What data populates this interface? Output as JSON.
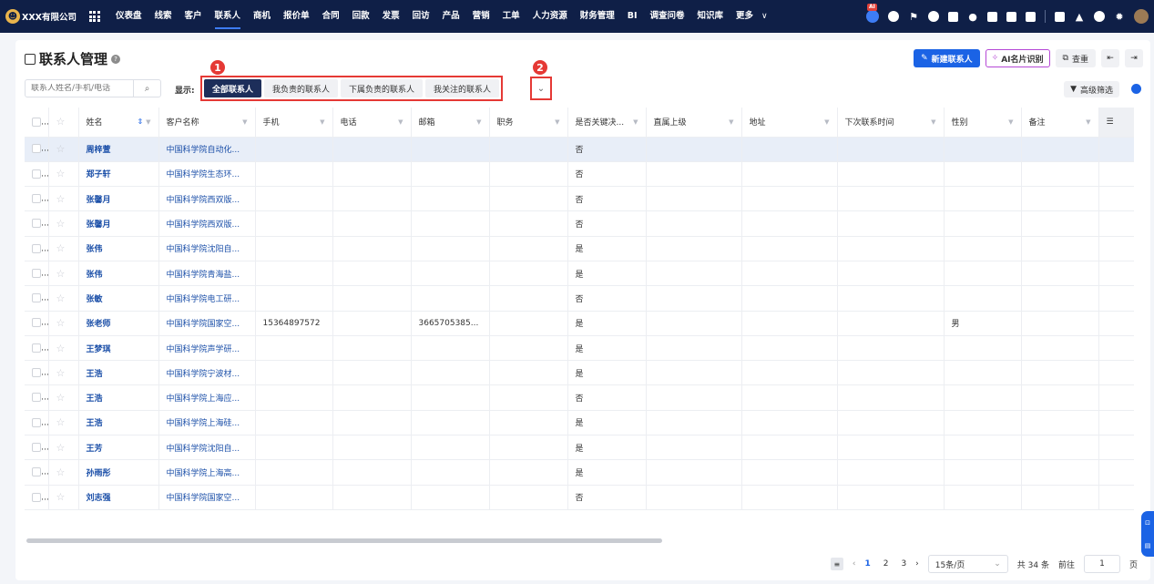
{
  "brand": {
    "name": "XXX有限公司"
  },
  "nav": {
    "items": [
      "仪表盘",
      "线索",
      "客户",
      "联系人",
      "商机",
      "报价单",
      "合同",
      "回款",
      "发票",
      "回访",
      "产品",
      "营销",
      "工单",
      "人力资源",
      "财务管理",
      "BI",
      "调查问卷",
      "知识库",
      "更多"
    ],
    "active": "联系人",
    "more_glyph": "∨",
    "ai_badge": "AI"
  },
  "page": {
    "title": "联系人管理",
    "help": "?"
  },
  "actions": {
    "new_contact": "新建联系人",
    "ai_card": "AI名片识别",
    "dedupe": "查重"
  },
  "search": {
    "placeholder": "联系人姓名/手机/电话"
  },
  "filters": {
    "show_label": "显示:",
    "tabs": [
      "全部联系人",
      "我负责的联系人",
      "下属负责的联系人",
      "我关注的联系人"
    ],
    "active_tab": "全部联系人",
    "advanced": "高级筛选"
  },
  "annotations": {
    "badge1": "1",
    "badge2": "2"
  },
  "table": {
    "columns": [
      "姓名",
      "客户名称",
      "手机",
      "电话",
      "邮箱",
      "职务",
      "是否关键决...",
      "直属上级",
      "地址",
      "下次联系时间",
      "性别",
      "备注"
    ],
    "rows": [
      {
        "name": "周梓萱",
        "customer": "中国科学院自动化...",
        "mobile": "",
        "phone": "",
        "email": "",
        "title": "",
        "key": "否",
        "boss": "",
        "addr": "",
        "next": "",
        "gender": "",
        "note": ""
      },
      {
        "name": "郑子轩",
        "customer": "中国科学院生态环...",
        "mobile": "",
        "phone": "",
        "email": "",
        "title": "",
        "key": "否",
        "boss": "",
        "addr": "",
        "next": "",
        "gender": "",
        "note": ""
      },
      {
        "name": "张馨月",
        "customer": "中国科学院西双版...",
        "mobile": "",
        "phone": "",
        "email": "",
        "title": "",
        "key": "否",
        "boss": "",
        "addr": "",
        "next": "",
        "gender": "",
        "note": ""
      },
      {
        "name": "张馨月",
        "customer": "中国科学院西双版...",
        "mobile": "",
        "phone": "",
        "email": "",
        "title": "",
        "key": "否",
        "boss": "",
        "addr": "",
        "next": "",
        "gender": "",
        "note": ""
      },
      {
        "name": "张伟",
        "customer": "中国科学院沈阳自...",
        "mobile": "",
        "phone": "",
        "email": "",
        "title": "",
        "key": "是",
        "boss": "",
        "addr": "",
        "next": "",
        "gender": "",
        "note": ""
      },
      {
        "name": "张伟",
        "customer": "中国科学院青海盐...",
        "mobile": "",
        "phone": "",
        "email": "",
        "title": "",
        "key": "是",
        "boss": "",
        "addr": "",
        "next": "",
        "gender": "",
        "note": ""
      },
      {
        "name": "张敏",
        "customer": "中国科学院电工研...",
        "mobile": "",
        "phone": "",
        "email": "",
        "title": "",
        "key": "否",
        "boss": "",
        "addr": "",
        "next": "",
        "gender": "",
        "note": ""
      },
      {
        "name": "张老师",
        "customer": "中国科学院国家空...",
        "mobile": "15364897572",
        "phone": "",
        "email": "3665705385...",
        "title": "",
        "key": "是",
        "boss": "",
        "addr": "",
        "next": "",
        "gender": "男",
        "note": ""
      },
      {
        "name": "王梦琪",
        "customer": "中国科学院声学研...",
        "mobile": "",
        "phone": "",
        "email": "",
        "title": "",
        "key": "是",
        "boss": "",
        "addr": "",
        "next": "",
        "gender": "",
        "note": ""
      },
      {
        "name": "王浩",
        "customer": "中国科学院宁波材...",
        "mobile": "",
        "phone": "",
        "email": "",
        "title": "",
        "key": "是",
        "boss": "",
        "addr": "",
        "next": "",
        "gender": "",
        "note": ""
      },
      {
        "name": "王浩",
        "customer": "中国科学院上海应...",
        "mobile": "",
        "phone": "",
        "email": "",
        "title": "",
        "key": "否",
        "boss": "",
        "addr": "",
        "next": "",
        "gender": "",
        "note": ""
      },
      {
        "name": "王浩",
        "customer": "中国科学院上海硅...",
        "mobile": "",
        "phone": "",
        "email": "",
        "title": "",
        "key": "是",
        "boss": "",
        "addr": "",
        "next": "",
        "gender": "",
        "note": ""
      },
      {
        "name": "王芳",
        "customer": "中国科学院沈阳自...",
        "mobile": "",
        "phone": "",
        "email": "",
        "title": "",
        "key": "是",
        "boss": "",
        "addr": "",
        "next": "",
        "gender": "",
        "note": ""
      },
      {
        "name": "孙雨彤",
        "customer": "中国科学院上海高...",
        "mobile": "",
        "phone": "",
        "email": "",
        "title": "",
        "key": "是",
        "boss": "",
        "addr": "",
        "next": "",
        "gender": "",
        "note": ""
      },
      {
        "name": "刘志强",
        "customer": "中国科学院国家空...",
        "mobile": "",
        "phone": "",
        "email": "",
        "title": "",
        "key": "否",
        "boss": "",
        "addr": "",
        "next": "",
        "gender": "",
        "note": ""
      }
    ]
  },
  "pager": {
    "pages": [
      "1",
      "2",
      "3"
    ],
    "current": "1",
    "page_size": "15条/页",
    "total": "共 34 条",
    "goto_label": "前往",
    "goto_value": "1",
    "page_suffix": "页"
  },
  "colors": {
    "nav_bg": "#0f1f47",
    "primary": "#1b63e5",
    "annotation": "#e53935"
  }
}
